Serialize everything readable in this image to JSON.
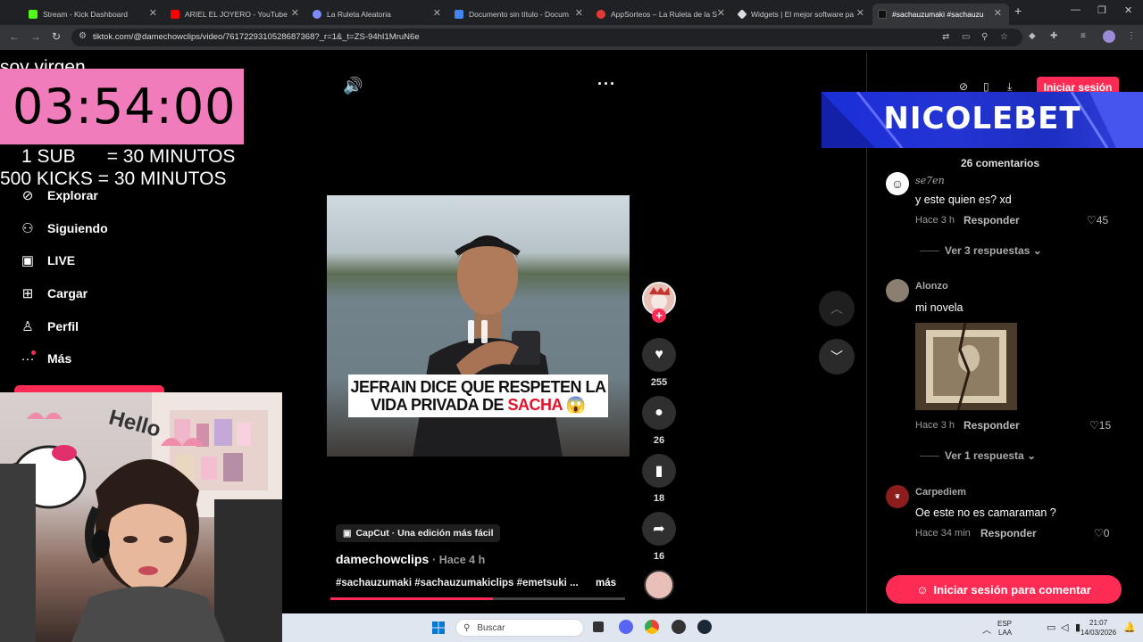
{
  "browser": {
    "tabs": [
      {
        "label": "Stream - Kick Dashboard",
        "color": "#53fc18"
      },
      {
        "label": "ARIEL EL JOYERO - YouTube",
        "color": "#ff0000"
      },
      {
        "label": "La Ruleta Aleatoria",
        "color": "#7b8cff"
      },
      {
        "label": "Documento sin título - Docum",
        "color": "#4285f4"
      },
      {
        "label": "AppSorteos – La Ruleta de la S",
        "color": "#e53935"
      },
      {
        "label": "Widgets | El mejor software pa",
        "color": "#dddddd"
      },
      {
        "label": "#sachauzumaki #sachauzu",
        "color": "#111111"
      }
    ],
    "url": "tiktok.com/@damechowclips/video/7617229310528687368?_r=1&_t=ZS-94hI1MruN6e"
  },
  "overlay": {
    "top_text": "soy virgen",
    "timer": "03:54:00",
    "rate1": "1 SUB      = 30 MINUTOS",
    "rate2": "500 KICKS = 30 MINUTOS"
  },
  "sidebar": {
    "items": [
      {
        "label": "Explorar",
        "icon": "compass-icon"
      },
      {
        "label": "Siguiendo",
        "icon": "user-follow-icon"
      },
      {
        "label": "LIVE",
        "icon": "live-tv-icon"
      },
      {
        "label": "Cargar",
        "icon": "upload-icon"
      },
      {
        "label": "Perfil",
        "icon": "person-icon"
      },
      {
        "label": "Más",
        "icon": "more-icon"
      }
    ]
  },
  "video": {
    "caption_line1": "JEFRAIN DICE QUE RESPETEN LA",
    "caption_line2_a": "VIDA PRIVADA DE ",
    "caption_line2_b": "SACHA",
    "caption_emoji": "😱",
    "capcut_label": "CapCut · Una edición más fácil",
    "author": "damechowclips",
    "time_ago": "· Hace 4 h",
    "hashtags": "#sachauzumaki #sachauzumakiclips #emetsuki ...",
    "more_label": "más",
    "progress": 0.55
  },
  "actions": {
    "likes": "255",
    "comments": "26",
    "saves": "18",
    "shares": "16"
  },
  "header": {
    "login_label": "Iniciar sesión"
  },
  "banner": {
    "text": "NICOLEBET"
  },
  "comments": {
    "count_label": "26 comentarios",
    "items": [
      {
        "user": "se7en",
        "text": "y este quien es? xd",
        "time": "Hace 3 h",
        "reply": "Responder",
        "likes": "45",
        "replies": "Ver 3 respuestas",
        "avatar_color": "#ffffff"
      },
      {
        "user": "Alonzo",
        "text": "mi novela",
        "time": "Hace 3 h",
        "reply": "Responder",
        "likes": "15",
        "replies": "Ver 1 respuesta",
        "avatar_color": "#8a7f70"
      },
      {
        "user": "Carpediem",
        "text": "Oe este no es camaraman ?",
        "time": "Hace 34 min",
        "reply": "Responder",
        "likes": "0",
        "replies": "",
        "avatar_color": "#8b1d1d"
      }
    ],
    "login_to_comment": "Iniciar sesión para comentar"
  },
  "taskbar": {
    "search_placeholder": "Buscar",
    "lang_top": "ESP",
    "lang_bottom": "LAA",
    "time": "21:07",
    "date": "14/03/2026"
  }
}
